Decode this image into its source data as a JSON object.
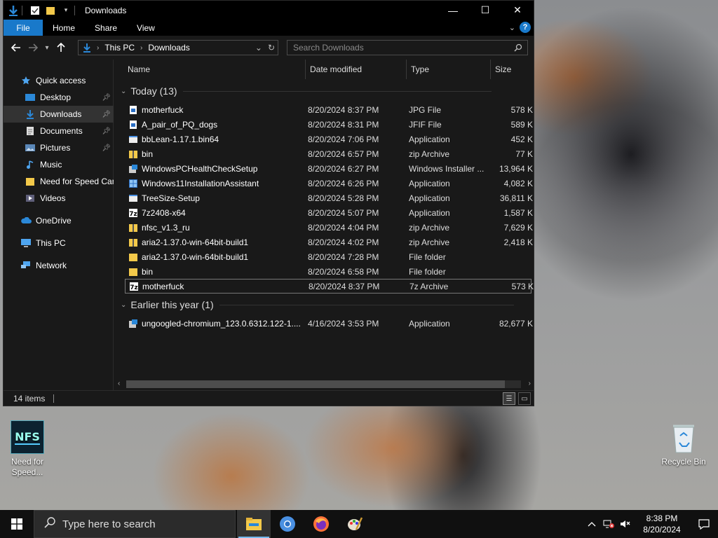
{
  "window": {
    "title": "Downloads",
    "controls": {
      "minimize": "—",
      "maximize": "☐",
      "close": "✕"
    }
  },
  "ribbon": {
    "tabs": [
      "File",
      "Home",
      "Share",
      "View"
    ],
    "help": "?"
  },
  "address": {
    "crumbs": [
      "This PC",
      "Downloads"
    ],
    "search_placeholder": "Search Downloads"
  },
  "nav": {
    "items": [
      {
        "label": "Quick access",
        "icon": "star-icon"
      },
      {
        "label": "Desktop",
        "icon": "desktop-icon",
        "pinned": true
      },
      {
        "label": "Downloads",
        "icon": "download-icon",
        "pinned": true,
        "selected": true
      },
      {
        "label": "Documents",
        "icon": "documents-icon",
        "pinned": true
      },
      {
        "label": "Pictures",
        "icon": "pictures-icon",
        "pinned": true
      },
      {
        "label": "Music",
        "icon": "music-icon"
      },
      {
        "label": "Need for Speed Car",
        "icon": "folder-icon"
      },
      {
        "label": "Videos",
        "icon": "videos-icon"
      },
      {
        "label": "OneDrive",
        "icon": "cloud-icon"
      },
      {
        "label": "This PC",
        "icon": "computer-icon"
      },
      {
        "label": "Network",
        "icon": "network-icon"
      }
    ]
  },
  "columns": [
    "Name",
    "Date modified",
    "Type",
    "Size"
  ],
  "groups": [
    {
      "label": "Today (13)"
    },
    {
      "label": "Earlier this year (1)"
    }
  ],
  "files_today": [
    {
      "name": "motherfuck",
      "date": "8/20/2024 8:37 PM",
      "type": "JPG File",
      "size": "578 K",
      "icon": "image-file-icon"
    },
    {
      "name": "A_pair_of_PQ_dogs",
      "date": "8/20/2024 8:31 PM",
      "type": "JFIF File",
      "size": "589 K",
      "icon": "image-file-icon"
    },
    {
      "name": "bbLean-1.17.1.bin64",
      "date": "8/20/2024 7:06 PM",
      "type": "Application",
      "size": "452 K",
      "icon": "app-icon"
    },
    {
      "name": "bin",
      "date": "8/20/2024 6:57 PM",
      "type": "zip Archive",
      "size": "77 K",
      "icon": "zip-icon"
    },
    {
      "name": "WindowsPCHealthCheckSetup",
      "date": "8/20/2024 6:27 PM",
      "type": "Windows Installer ...",
      "size": "13,964 K",
      "icon": "installer-icon"
    },
    {
      "name": "Windows11InstallationAssistant",
      "date": "8/20/2024 6:26 PM",
      "type": "Application",
      "size": "4,082 K",
      "icon": "windows-app-icon"
    },
    {
      "name": "TreeSize-Setup",
      "date": "8/20/2024 5:28 PM",
      "type": "Application",
      "size": "36,811 K",
      "icon": "app-icon"
    },
    {
      "name": "7z2408-x64",
      "date": "8/20/2024 5:07 PM",
      "type": "Application",
      "size": "1,587 K",
      "icon": "7z-icon"
    },
    {
      "name": "nfsc_v1.3_ru",
      "date": "8/20/2024 4:04 PM",
      "type": "zip Archive",
      "size": "7,629 K",
      "icon": "zip-icon"
    },
    {
      "name": "aria2-1.37.0-win-64bit-build1",
      "date": "8/20/2024 4:02 PM",
      "type": "zip Archive",
      "size": "2,418 K",
      "icon": "zip-icon"
    },
    {
      "name": "aria2-1.37.0-win-64bit-build1",
      "date": "8/20/2024 7:28 PM",
      "type": "File folder",
      "size": "",
      "icon": "folder-icon"
    },
    {
      "name": "bin",
      "date": "8/20/2024 6:58 PM",
      "type": "File folder",
      "size": "",
      "icon": "folder-icon"
    },
    {
      "name": "motherfuck",
      "date": "8/20/2024 8:37 PM",
      "type": "7z Archive",
      "size": "573 K",
      "icon": "7z-icon",
      "selected": true
    }
  ],
  "files_earlier": [
    {
      "name": "ungoogled-chromium_123.0.6312.122-1....",
      "date": "4/16/2024 3:53 PM",
      "type": "Application",
      "size": "82,677 K",
      "icon": "installer-icon"
    }
  ],
  "status": {
    "count": "14 items"
  },
  "desktop": {
    "nfs_label": "Need for Speed...",
    "recycle_label": "Recycle Bin"
  },
  "taskbar": {
    "search_placeholder": "Type here to search",
    "time": "8:38 PM",
    "date": "8/20/2024"
  },
  "colors": {
    "accent": "#1979ca",
    "folder": "#f3c94a"
  }
}
